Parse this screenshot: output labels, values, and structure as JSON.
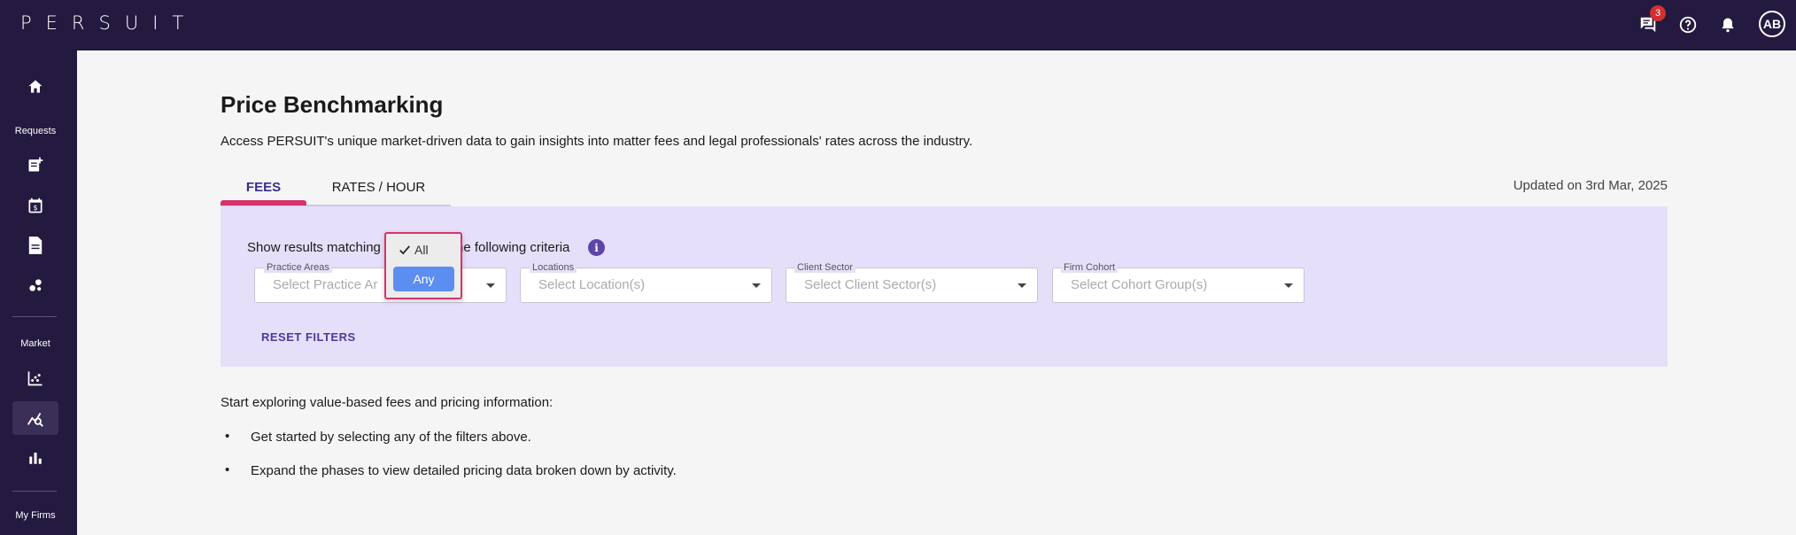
{
  "header": {
    "logo": "PERSUIT",
    "notification_count": "3",
    "avatar_initials": "AB"
  },
  "sidebar": {
    "requests_label": "Requests",
    "market_label": "Market",
    "my_firms_label": "My Firms"
  },
  "page": {
    "title": "Price Benchmarking",
    "description": "Access PERSUIT's unique market-driven data to gain insights into matter fees and legal professionals' rates across the industry.",
    "tabs": [
      {
        "label": "FEES"
      },
      {
        "label": "RATES / HOUR"
      }
    ],
    "updated": "Updated on 3rd Mar, 2025"
  },
  "filters": {
    "criteria_prefix": "Show results matching",
    "criteria_suffix": "he following criteria",
    "practice_label": "Practice Areas",
    "practice_placeholder": "Select Practice Ar",
    "locations_label": "Locations",
    "locations_placeholder": "Select Location(s)",
    "client_sector_label": "Client Sector",
    "client_sector_placeholder": "Select Client Sector(s)",
    "firm_cohort_label": "Firm Cohort",
    "firm_cohort_placeholder": "Select Cohort Group(s)",
    "reset_label": "RESET FILTERS",
    "match_options": [
      "All",
      "Any"
    ],
    "selected_option": "All"
  },
  "info": {
    "intro": "Start exploring value-based fees and pricing information:",
    "bullets": [
      "Get started by selecting any of the filters above.",
      "Expand the phases to view detailed pricing data broken down by activity."
    ]
  },
  "colors": {
    "nav_bg": "#24193f",
    "panel_bg": "#e6dffa",
    "accent": "#3b2d8a",
    "tab_indicator": "#d6336c",
    "highlight": "#5b8ef0"
  }
}
